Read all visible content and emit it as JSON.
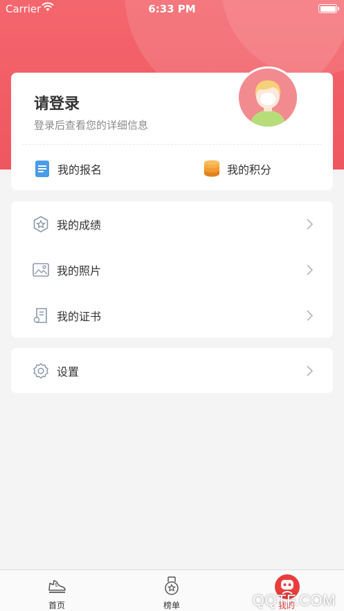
{
  "status_bar": {
    "carrier": "Carrier",
    "time": "6:33 PM"
  },
  "profile": {
    "title": "请登录",
    "subtitle": "登录后查看您的详细信息",
    "quick_links": [
      {
        "label": "我的报名",
        "icon": "document-icon"
      },
      {
        "label": "我的积分",
        "icon": "coins-icon"
      }
    ]
  },
  "menu": [
    {
      "label": "我的成绩",
      "icon": "star-badge-icon"
    },
    {
      "label": "我的照片",
      "icon": "photo-icon"
    },
    {
      "label": "我的证书",
      "icon": "certificate-icon"
    }
  ],
  "settings": {
    "label": "设置",
    "icon": "gear-icon"
  },
  "tabbar": [
    {
      "label": "首页",
      "icon": "sneaker-icon"
    },
    {
      "label": "榜单",
      "icon": "medal-icon"
    },
    {
      "label": "我的",
      "icon": "user-icon",
      "active": true
    }
  ],
  "watermark": "QQTF.COM",
  "colors": {
    "accent": "#ef5660",
    "active_tab": "#e93c3c",
    "coin": "#f29a2e",
    "doc": "#4a9be8"
  }
}
